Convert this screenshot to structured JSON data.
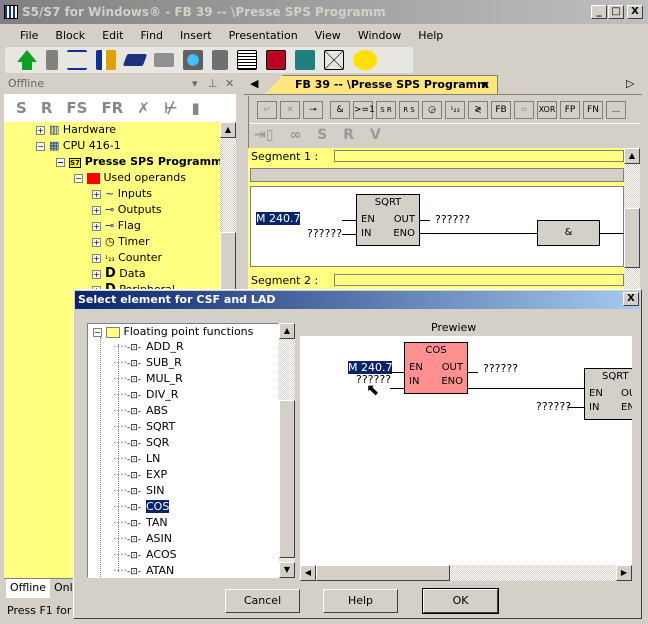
{
  "window": {
    "title": "S5/S7 for Windows® - FB 39 -- \\Presse SPS Programm",
    "min": "_",
    "max": "□",
    "close": "X"
  },
  "menu": [
    "File",
    "Block",
    "Edit",
    "Find",
    "Insert",
    "Presentation",
    "View",
    "Window",
    "Help"
  ],
  "toolbar_icons": [
    "upload-icon",
    "block-icon",
    "compare-icon",
    "diagnostics-icon",
    "plc-icon",
    "plc-disabled-icon",
    "network-icon",
    "hardware-icon",
    "list-icon",
    "cross-reference-icon",
    "io-icon",
    "envelope-icon",
    "help-icon"
  ],
  "left_panel": {
    "title": "Offline",
    "toolbar": [
      "S",
      "R",
      "FS",
      "FR"
    ],
    "tree": [
      {
        "label": "Hardware",
        "level": 2,
        "sign": "+"
      },
      {
        "label": "CPU 416-1",
        "level": 2,
        "sign": "-"
      },
      {
        "label": "Presse SPS Programm",
        "level": 3,
        "sign": "-",
        "bold": true
      },
      {
        "label": "Used operands",
        "level": 4,
        "sign": "-"
      },
      {
        "label": "Inputs",
        "level": 5,
        "sign": "+"
      },
      {
        "label": "Outputs",
        "level": 5,
        "sign": "+"
      },
      {
        "label": "Flag",
        "level": 5,
        "sign": "+"
      },
      {
        "label": "Timer",
        "level": 5,
        "sign": "+"
      },
      {
        "label": "Counter",
        "level": 5,
        "sign": "+"
      },
      {
        "label": "Data",
        "level": 5,
        "sign": "+"
      },
      {
        "label": "Peripheral",
        "level": 5,
        "sign": "+"
      }
    ],
    "tabs": [
      "Offline",
      "Onl"
    ]
  },
  "editor": {
    "tab": "FB 39 -- \\Presse SPS Programm",
    "tab_close": "x",
    "lad_toolbar": [
      "&",
      ">=1",
      "S R",
      "R S",
      "FB",
      "=",
      "XOR",
      "FP",
      "FN",
      "..."
    ],
    "lad_toolbar2": [
      "S",
      "R",
      "V"
    ],
    "segment1": "Segment 1 :",
    "segment2": "Segment 2 :",
    "block": {
      "name": "SQRT",
      "en": "EN",
      "in": "IN",
      "out": "OUT",
      "eno": "ENO"
    },
    "operand": "M 240.7",
    "placeholder": "??????",
    "and": "&"
  },
  "status": "Press F1 for H",
  "dialog": {
    "title": "Select element for CSF and LAD",
    "close": "X",
    "folder": "Floating point functions",
    "items": [
      "ADD_R",
      "SUB_R",
      "MUL_R",
      "DIV_R",
      "ABS",
      "SQRT",
      "SQR",
      "LN",
      "EXP",
      "SIN",
      "COS",
      "TAN",
      "ASIN",
      "ACOS",
      "ATAN"
    ],
    "selected": "COS",
    "preview_label": "Prewiew",
    "preview": {
      "block": "COS",
      "en": "EN",
      "in": "IN",
      "out": "OUT",
      "eno": "ENO",
      "operand": "M 240.7",
      "placeholder": "??????",
      "next_block": "SQRT",
      "next_en": "EN",
      "next_in": "IN",
      "next_out": "OU",
      "next_eno": "EN"
    },
    "cos_color": "#ff9090",
    "buttons": {
      "cancel": "Cancel",
      "help": "Help",
      "ok": "OK"
    }
  }
}
